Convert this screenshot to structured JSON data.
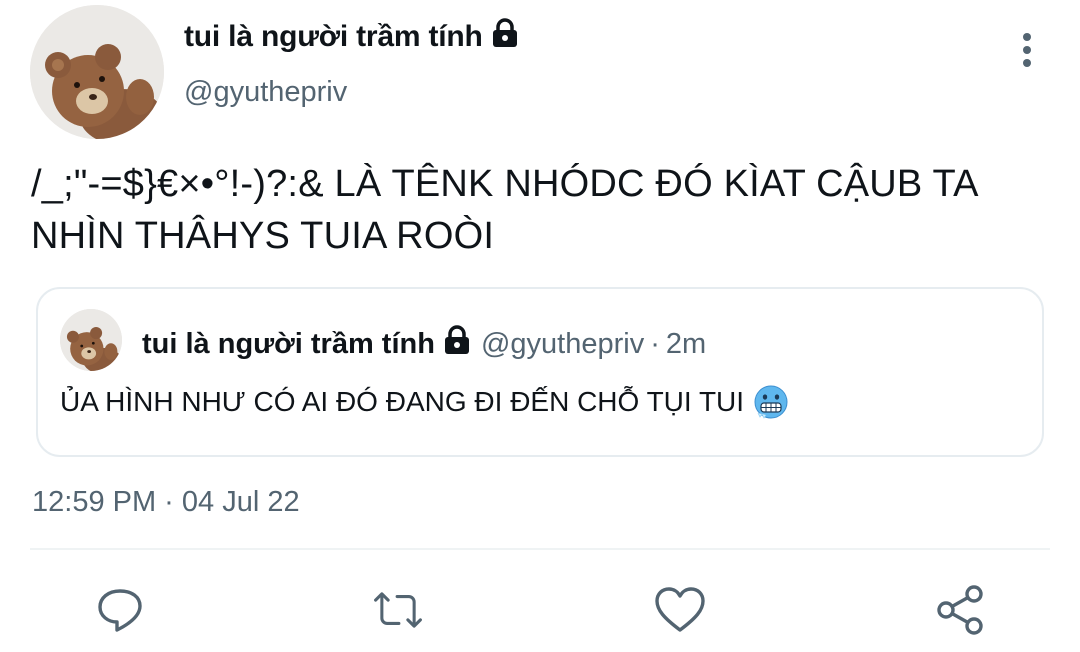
{
  "author": {
    "display_name": "tui là người trầm tính",
    "handle": "@gyuthepriv",
    "avatar_icon": "teddy-bear-avatar",
    "protected_icon": "lock-icon"
  },
  "tweet": {
    "text": "/_;\"-=$}€×•°!-)?:& LÀ TÊNK NHÓDC ĐÓ KÌAT CẬUB TA NHÌN THÂHYS TUIA ROÒI",
    "timestamp": "12:59 PM · 04 Jul 22"
  },
  "quoted_tweet": {
    "display_name": "tui là người trầm tính",
    "handle": "@gyuthepriv",
    "separator": "·",
    "time": "2m",
    "text": "ỦA HÌNH NHƯ CÓ AI ĐÓ ĐANG ĐI ĐẾN CHỖ TỤI TUI",
    "emoji_icon": "cold-face-emoji-icon"
  },
  "actions": {
    "reply_icon": "reply-icon",
    "retweet_icon": "retweet-icon",
    "like_icon": "heart-icon",
    "share_icon": "share-icon"
  },
  "colors": {
    "text_primary": "#0f1419",
    "text_secondary": "#536471",
    "border": "#e6ecf0",
    "background": "#ffffff"
  }
}
